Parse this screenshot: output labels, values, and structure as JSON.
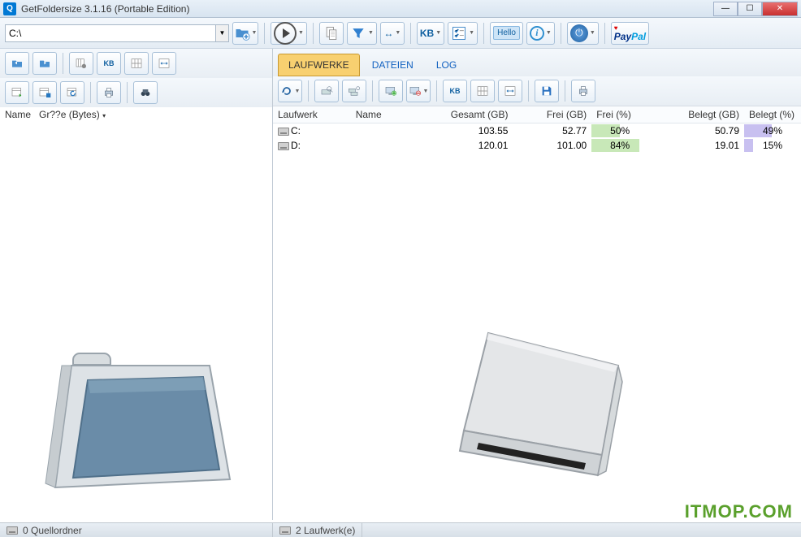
{
  "window": {
    "title": "GetFoldersize 3.1.16 (Portable Edition)"
  },
  "path": {
    "value": "C:\\"
  },
  "toolbar_labels": {
    "kb": "KB",
    "hello": "Hello"
  },
  "left_headers": {
    "name": "Name",
    "size": "Gr??e (Bytes)"
  },
  "tabs": {
    "drives": "LAUFWERKE",
    "files": "DATEIEN",
    "log": "LOG"
  },
  "drive_columns": {
    "laufwerk": "Laufwerk",
    "name": "Name",
    "gesamt": "Gesamt (GB)",
    "frei_gb": "Frei (GB)",
    "frei_pct": "Frei (%)",
    "belegt_gb": "Belegt (GB)",
    "belegt_pct": "Belegt (%)"
  },
  "drives": [
    {
      "letter": "C:",
      "name": "",
      "total": "103.55",
      "free_gb": "52.77",
      "free_pct": "50%",
      "free_pct_num": 50,
      "used_gb": "50.79",
      "used_pct": "49%",
      "used_pct_num": 49
    },
    {
      "letter": "D:",
      "name": "",
      "total": "120.01",
      "free_gb": "101.00",
      "free_pct": "84%",
      "free_pct_num": 84,
      "used_gb": "19.01",
      "used_pct": "15%",
      "used_pct_num": 15
    }
  ],
  "status": {
    "left": "0 Quellordner",
    "right": "2 Laufwerk(e)"
  },
  "watermark": "ITMOP.COM"
}
